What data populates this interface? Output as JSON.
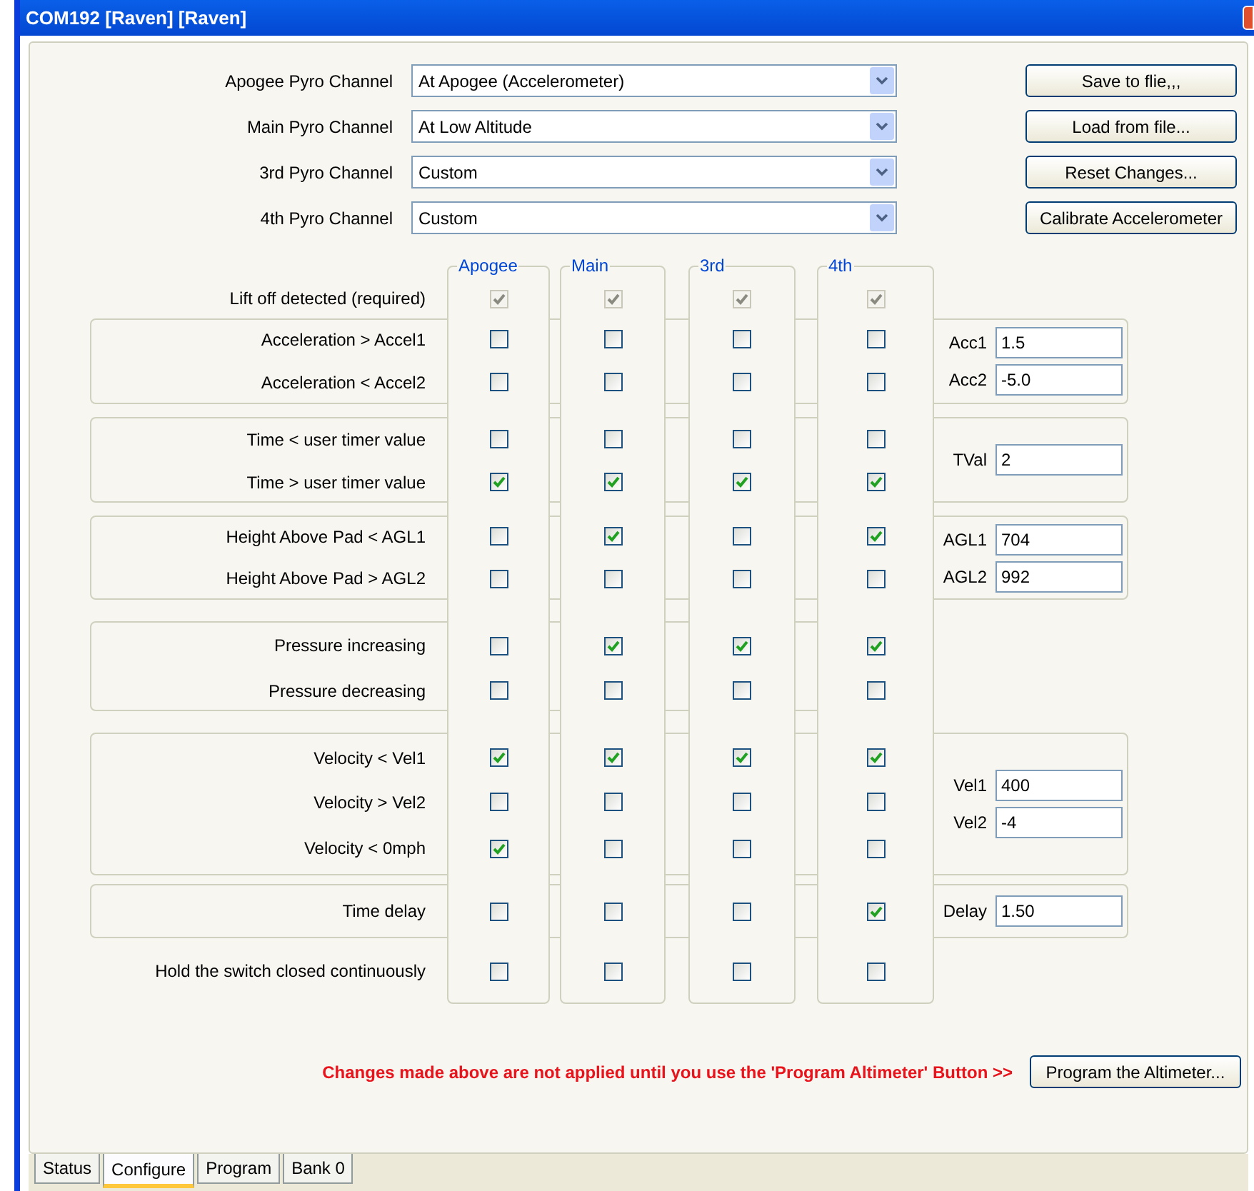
{
  "window": {
    "title": "COM192 [Raven] [Raven]"
  },
  "channels": [
    {
      "label": "Apogee Pyro Channel",
      "value": "At Apogee (Accelerometer)"
    },
    {
      "label": "Main Pyro Channel",
      "value": "At Low Altitude"
    },
    {
      "label": "3rd Pyro Channel",
      "value": "Custom"
    },
    {
      "label": "4th Pyro Channel",
      "value": "Custom"
    }
  ],
  "buttons": [
    "Save to flie,,,",
    "Load from file...",
    "Reset Changes...",
    "Calibrate Accelerometer"
  ],
  "columns": [
    "Apogee",
    "Main",
    "3rd",
    "4th"
  ],
  "groups": [
    {
      "framed": false,
      "rows": [
        {
          "label": "Lift off detected (required)",
          "disabled": true,
          "checks": [
            true,
            true,
            true,
            true
          ]
        }
      ]
    },
    {
      "framed": true,
      "fields": [
        {
          "label": "Acc1",
          "value": "1.5"
        },
        {
          "label": "Acc2",
          "value": "-5.0"
        }
      ],
      "rows": [
        {
          "label": "Acceleration > Accel1",
          "disabled": false,
          "checks": [
            false,
            false,
            false,
            false
          ]
        },
        {
          "label": "Acceleration < Accel2",
          "disabled": false,
          "checks": [
            false,
            false,
            false,
            false
          ]
        }
      ]
    },
    {
      "framed": true,
      "fields": [
        {
          "label": "TVal",
          "value": "2"
        }
      ],
      "rows": [
        {
          "label": "Time < user timer value",
          "disabled": false,
          "checks": [
            false,
            false,
            false,
            false
          ]
        },
        {
          "label": "Time > user timer value",
          "disabled": false,
          "checks": [
            true,
            true,
            true,
            true
          ]
        }
      ]
    },
    {
      "framed": true,
      "fields": [
        {
          "label": "AGL1",
          "value": "704"
        },
        {
          "label": "AGL2",
          "value": "992"
        }
      ],
      "rows": [
        {
          "label": "Height Above Pad < AGL1",
          "disabled": false,
          "checks": [
            false,
            true,
            false,
            true
          ]
        },
        {
          "label": "Height Above Pad > AGL2",
          "disabled": false,
          "checks": [
            false,
            false,
            false,
            false
          ]
        }
      ]
    },
    {
      "framed": true,
      "rows": [
        {
          "label": "Pressure increasing",
          "disabled": false,
          "checks": [
            false,
            true,
            true,
            true
          ]
        },
        {
          "label": "Pressure decreasing",
          "disabled": false,
          "checks": [
            false,
            false,
            false,
            false
          ]
        }
      ]
    },
    {
      "framed": true,
      "fields": [
        {
          "label": "Vel1",
          "value": "400"
        },
        {
          "label": "Vel2",
          "value": "-4"
        }
      ],
      "rows": [
        {
          "label": "Velocity < Vel1",
          "disabled": false,
          "checks": [
            true,
            true,
            true,
            true
          ]
        },
        {
          "label": "Velocity > Vel2",
          "disabled": false,
          "checks": [
            false,
            false,
            false,
            false
          ]
        },
        {
          "label": "Velocity < 0mph",
          "disabled": false,
          "checks": [
            true,
            false,
            false,
            false
          ]
        }
      ]
    },
    {
      "framed": true,
      "fields": [
        {
          "label": "Delay",
          "value": "1.50"
        }
      ],
      "rows": [
        {
          "label": "Time delay",
          "disabled": false,
          "checks": [
            false,
            false,
            false,
            true
          ]
        }
      ]
    },
    {
      "framed": false,
      "rows": [
        {
          "label": "Hold the switch closed continuously",
          "disabled": false,
          "checks": [
            false,
            false,
            false,
            false
          ]
        }
      ]
    }
  ],
  "warning": "Changes made above are not applied until you use the 'Program Altimeter' Button >>",
  "program_button": "Program the Altimeter...",
  "tabs": [
    {
      "label": "Status",
      "selected": false
    },
    {
      "label": "Configure",
      "selected": true
    },
    {
      "label": "Program",
      "selected": false
    },
    {
      "label": "Bank 0",
      "selected": false
    }
  ]
}
